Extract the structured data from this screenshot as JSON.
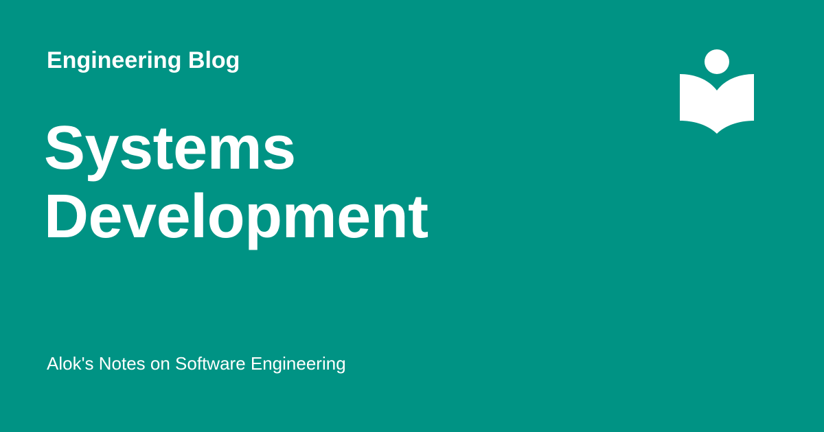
{
  "colors": {
    "background": "#009384",
    "text": "#ffffff"
  },
  "header": {
    "site_name": "Engineering Blog",
    "logo_icon": "open-book-reader-icon"
  },
  "main": {
    "title_lines": [
      "Systems",
      "Development"
    ]
  },
  "footer": {
    "tagline": "Alok's Notes on Software Engineering"
  }
}
